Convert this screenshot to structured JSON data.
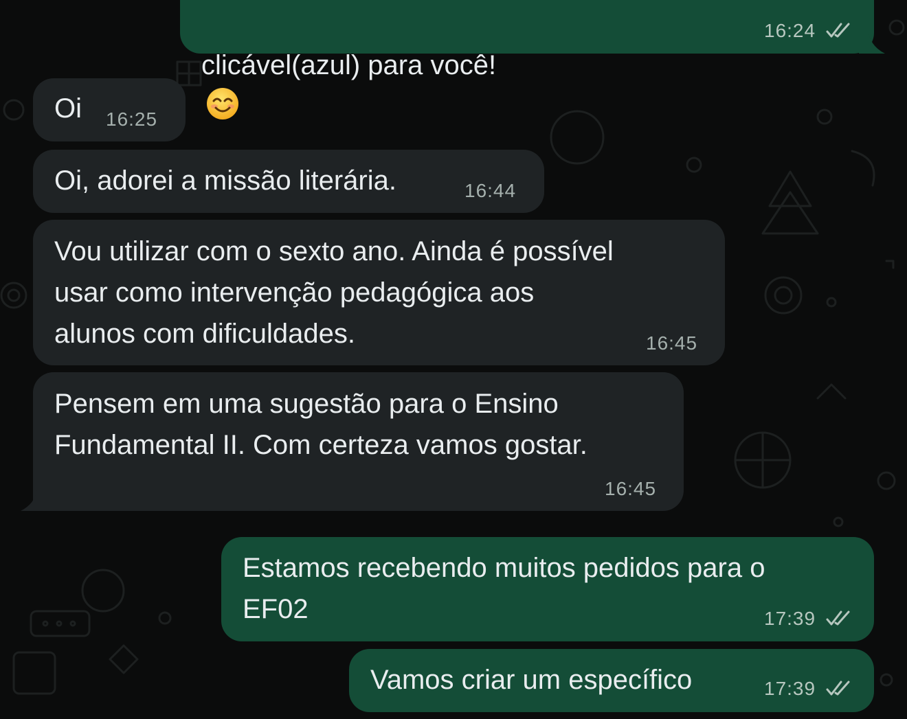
{
  "colors": {
    "background": "#0b0c0c",
    "incoming_bubble": "#1f2325",
    "outgoing_bubble": "#144d37",
    "text": "#e9edef",
    "timestamp": "#a5b0ad",
    "read_ticks": "#b7c7bf"
  },
  "messages": [
    {
      "direction": "outgoing",
      "text": "clicável(azul) para você!",
      "emoji": "smiling-face-emoji",
      "time": "16:24",
      "status": "read"
    },
    {
      "direction": "incoming",
      "text": "Oi",
      "time": "16:25"
    },
    {
      "direction": "incoming",
      "text": "Oi, adorei a missão literária.",
      "time": "16:44"
    },
    {
      "direction": "incoming",
      "text": "Vou utilizar com o sexto ano. Ainda é possível\nusar como intervenção pedagógica aos\nalunos com dificuldades.",
      "time": "16:45"
    },
    {
      "direction": "incoming",
      "text": "Pensem em uma sugestão para o Ensino\nFundamental II. Com certeza vamos gostar.",
      "time": "16:45"
    },
    {
      "direction": "outgoing",
      "text": "Estamos recebendo muitos pedidos para o\nEF02",
      "time": "17:39",
      "status": "read"
    },
    {
      "direction": "outgoing",
      "text": "Vamos criar um específico",
      "time": "17:39",
      "status": "read"
    }
  ]
}
